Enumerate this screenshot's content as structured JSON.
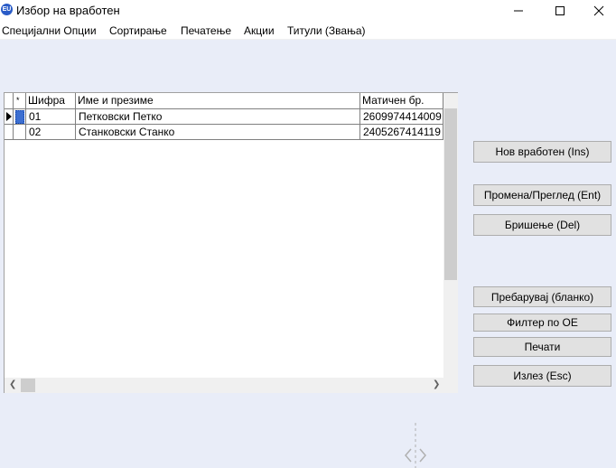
{
  "window": {
    "title": "Избор на вработен",
    "icon": "app-logo-icon",
    "icon_text": "EU"
  },
  "menu": [
    {
      "label": "Специјални Опции"
    },
    {
      "label": "Сортирање"
    },
    {
      "label": "Печатење"
    },
    {
      "label": "Акции"
    },
    {
      "label": "Титули (Звања)"
    }
  ],
  "grid": {
    "headers": {
      "marker": "*",
      "code": "Шифра",
      "name": "Име и презиме",
      "id_number": "Матичен бр."
    },
    "rows": [
      {
        "code": "01",
        "name": "Петковски Петко",
        "id_number": "2609974414009",
        "current": true
      },
      {
        "code": "02",
        "name": "Станковски  Станко",
        "id_number": "2405267414119",
        "current": false
      }
    ]
  },
  "buttons": {
    "new": "Нов вработен (Ins)",
    "edit": "Промена/Преглед (Ent)",
    "delete": "Бришење (Del)",
    "search": "Пребарувај (бланко)",
    "filter": "Филтер по ОЕ",
    "print": "Печати",
    "exit": "Излез (Esc)"
  },
  "colors": {
    "background": "#e9edf8",
    "button": "#e1e1e1"
  }
}
